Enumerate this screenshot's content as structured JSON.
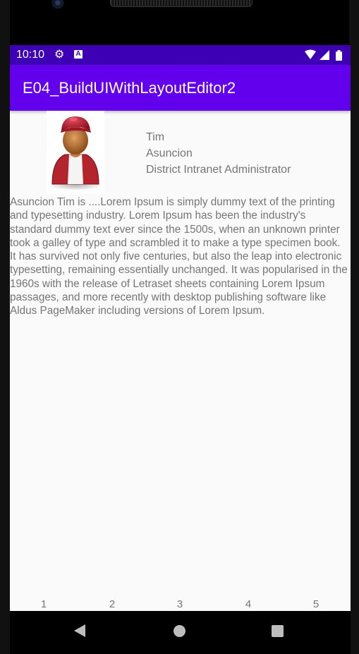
{
  "status_bar": {
    "time": "10:10",
    "icons": [
      "gear-icon",
      "accessibility-a-icon",
      "wifi-icon",
      "signal-icon",
      "battery-icon"
    ]
  },
  "app_bar": {
    "title": "E04_BuildUIWithLayoutEditor2"
  },
  "profile": {
    "avatar_icon": "person-avatar-icon",
    "first_name": "Tim",
    "last_name": "Asuncion",
    "job_title": "District Intranet Administrator"
  },
  "description": "Asuncion Tim is ....Lorem Ipsum is simply dummy text of the printing and typesetting industry. Lorem Ipsum has been the industry's standard dummy text ever since the 1500s, when an unknown printer took a galley of type and scrambled it to make a type specimen book. It has survived not only five centuries, but also the leap into electronic typesetting, remaining essentially unchanged. It was popularised in the 1960s with the release of Letraset sheets containing Lorem Ipsum passages, and more recently with desktop publishing software like Aldus PageMaker including versions of Lorem Ipsum.",
  "pagination": [
    "1",
    "2",
    "3",
    "4",
    "5"
  ],
  "nav_bar": {
    "icons": [
      "back-icon",
      "home-icon",
      "recents-icon"
    ]
  },
  "colors": {
    "status_bar": "#3d00b5",
    "app_bar": "#6200ee",
    "background": "#fafafa",
    "text_secondary": "#757575"
  }
}
